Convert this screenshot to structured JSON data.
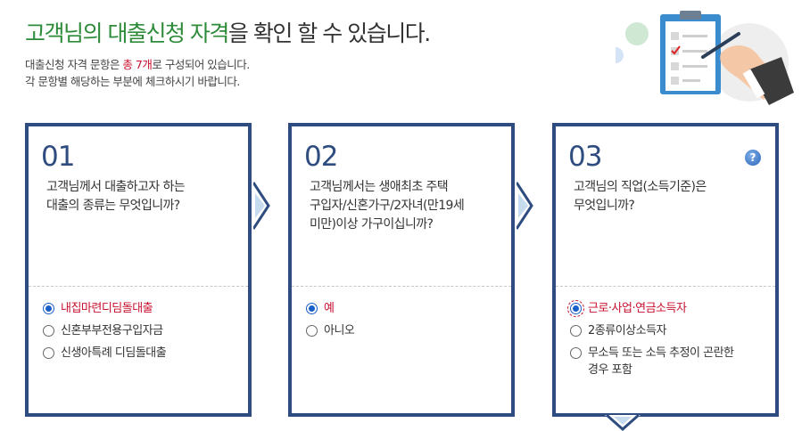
{
  "header": {
    "title_part1": "고객님의 대출신청 자격",
    "title_part2": "을 확인 할 수 있습니다.",
    "sub_line1_a": "대출신청 자격 문항은 ",
    "sub_line1_hl": "총 7개",
    "sub_line1_b": "로 구성되어 있습니다.",
    "sub_line2": "각 문항별 해당하는 부분에 체크하시기 바랍니다."
  },
  "questions": [
    {
      "num": "01",
      "q_lines": [
        "고객님께서 대출하고자 하는",
        "대출의 종류는 무엇입니까?"
      ],
      "options": [
        "내집마련디딤돌대출",
        "신혼부부전용구입자금",
        "신생아특례 디딤돌대출"
      ],
      "selected": 0
    },
    {
      "num": "02",
      "q_lines": [
        "고객님께서는 생애최초 주택",
        "구입자/신혼가구/2자녀(만19세",
        "미만)이상 가구이십니까?"
      ],
      "options": [
        "예",
        "아니오"
      ],
      "selected": 0
    },
    {
      "num": "03",
      "q_lines": [
        "고객님의 직업(소득기준)은",
        "무엇입니까?"
      ],
      "options": [
        "근로·사업·연금소득자",
        "2종류이상소득자",
        "무소득 또는 소득 추정이 곤란한",
        "경우 포함"
      ],
      "selected": 0,
      "help": "?"
    }
  ],
  "icons": {
    "help": "help-icon",
    "next": "chevron-right-icon",
    "down": "chevron-down-icon",
    "illustration": "checklist-clipboard-icon"
  },
  "colors": {
    "accent_green": "#2e8b3a",
    "card_border": "#2f4c80",
    "highlight_red": "#c8102e",
    "radio_blue": "#1a5fc9"
  }
}
